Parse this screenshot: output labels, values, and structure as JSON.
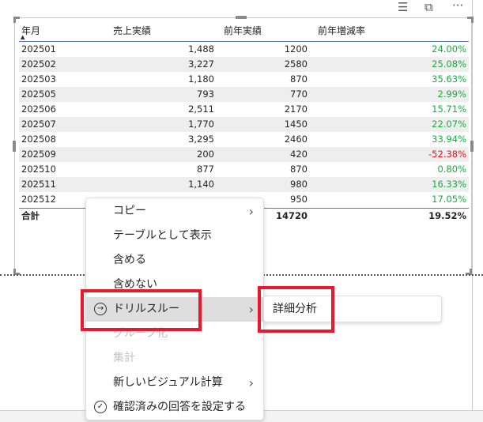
{
  "toolbar": {
    "filter_icon": "filter-icon",
    "focus_icon": "focus-mode-icon",
    "more_icon": "more-options-icon",
    "more_label": "···"
  },
  "table": {
    "headers": [
      "年月",
      "売上実績",
      "前年実績",
      "前年増減率"
    ],
    "sort_indicator": "▲",
    "rows": [
      [
        "202501",
        "1,488",
        "1200",
        "24.00%"
      ],
      [
        "202502",
        "3,227",
        "2580",
        "25.08%"
      ],
      [
        "202503",
        "1,180",
        "870",
        "35.63%"
      ],
      [
        "202505",
        "793",
        "770",
        "2.99%"
      ],
      [
        "202506",
        "2,511",
        "2170",
        "15.71%"
      ],
      [
        "202507",
        "1,770",
        "1450",
        "22.07%"
      ],
      [
        "202508",
        "3,295",
        "2460",
        "33.94%"
      ],
      [
        "202509",
        "200",
        "420",
        "-52.38%"
      ],
      [
        "202510",
        "877",
        "870",
        "0.80%"
      ],
      [
        "202511",
        "1,140",
        "980",
        "16.33%"
      ],
      [
        "202512",
        "",
        "950",
        "17.05%"
      ]
    ],
    "total": [
      "合計",
      "",
      "14720",
      "19.52%"
    ],
    "colors": {
      "positive": "#1aab40",
      "negative": "#e81123"
    }
  },
  "context_menu": {
    "items": [
      {
        "label": "コピー",
        "submenu": true
      },
      {
        "label": "テーブルとして表示"
      },
      {
        "label": "含める"
      },
      {
        "label": "含めない"
      },
      {
        "label": "ドリルスルー",
        "submenu": true,
        "icon": "drillthrough-icon",
        "highlighted": true
      },
      {
        "label": "グループ化",
        "disabled": true
      },
      {
        "label": "集計",
        "disabled": true
      },
      {
        "label": "新しいビジュアル計算",
        "submenu": true
      },
      {
        "label": "確認済みの回答を設定する",
        "icon": "check-circle-icon"
      }
    ],
    "submenu": {
      "items": [
        "詳細分析"
      ]
    },
    "highlight_color": "#e8192c"
  }
}
